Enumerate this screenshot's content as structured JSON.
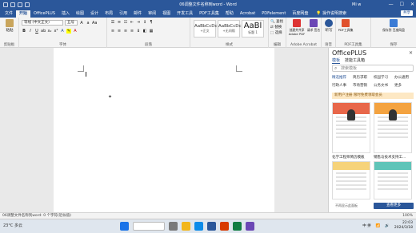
{
  "window": {
    "title": "06调整文件名称到word - Word",
    "user": "Mi w",
    "min": "—",
    "max": "☐",
    "close": "✕"
  },
  "tabs": [
    "文件",
    "开始",
    "OfficePLUS",
    "插入",
    "绘图",
    "设计",
    "布局",
    "引用",
    "邮件",
    "审阅",
    "视图",
    "开发工具",
    "PDF工具集",
    "帮助",
    "Acrobat",
    "PDFelement",
    "百度网盘"
  ],
  "active_tab": "开始",
  "search_text": "操作说明搜索",
  "share_label": "共享",
  "ribbon": {
    "clipboard": {
      "paste": "粘贴",
      "label": "剪贴板"
    },
    "font": {
      "name": "等线 (中文正文)",
      "size": "五号",
      "label": "字体",
      "bold": "B",
      "italic": "I",
      "underline": "U"
    },
    "paragraph": {
      "label": "段落"
    },
    "styles": {
      "items": [
        {
          "preview": "AaBbCcDc",
          "name": "+正文"
        },
        {
          "preview": "AaBbCcDc",
          "name": "+无间隔"
        },
        {
          "preview": "AaBl",
          "name": "标题 1"
        }
      ],
      "label": "样式"
    },
    "editing": {
      "find": "查找",
      "replace": "替换",
      "select": "选择",
      "label": "编辑"
    },
    "acrobat": {
      "create": "创建并共享 Adobe PDF",
      "request": "请求 签名",
      "label": "Adobe Acrobat"
    },
    "voice": {
      "dictate": "听写",
      "label": "语音"
    },
    "addins": {
      "pdf": "PDF工具集",
      "label": "PDF工具集"
    },
    "save_baidu": {
      "btn": "保存到 百度网盘",
      "label": "保存"
    }
  },
  "pane": {
    "title": "OfficePLUS",
    "close": "✕",
    "tabs": [
      "模板",
      "技能工具箱"
    ],
    "search_placeholder": "搜索模板",
    "categories": [
      "精选推荐",
      "简历求职",
      "校园学习",
      "办公通用",
      "行政人事",
      "市场营销",
      "公务文书",
      "更多"
    ],
    "banner": "新用户注册 限时免费领取会员",
    "captions": [
      "化学工程师简历模板",
      "销售与技术支持工..."
    ],
    "unselect": "不再显示此面板",
    "more": "查看更多"
  },
  "status": {
    "text": "06调整文件名称到word: 0 个字符(近似值)",
    "zoom": "100%"
  },
  "taskbar": {
    "weather": "23°C 多云",
    "search": "搜索",
    "tray": "中 拼",
    "time": "22:03",
    "date": "2024/3/18"
  },
  "colors": {
    "accent": "#2b579a",
    "ribbon_bg": "#f3f3f3",
    "doc_bg": "#e9e9e9"
  }
}
